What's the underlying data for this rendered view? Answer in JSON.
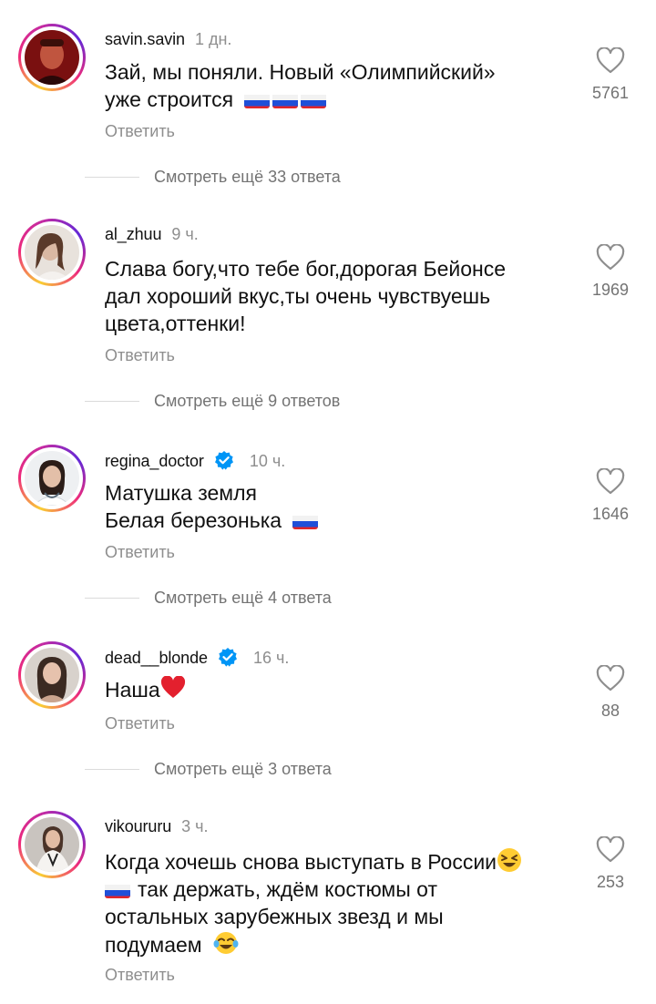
{
  "comments": [
    {
      "username": "savin.savin",
      "time": "1 дн.",
      "verified": false,
      "lines": [
        "Зай, мы поняли. Новый «Олимпийский»",
        "уже строится"
      ],
      "likes": "5761",
      "reply_label": "Ответить",
      "more_replies": "Смотреть ещё 33 ответа"
    },
    {
      "username": "al_zhuu",
      "time": "9 ч.",
      "verified": false,
      "lines": [
        "Слава богу,что тебе бог,дорогая Бейонсе",
        "дал хороший вкус,ты очень чувствуешь",
        "цвета,оттенки!"
      ],
      "likes": "1969",
      "reply_label": "Ответить",
      "more_replies": "Смотреть ещё 9 ответов"
    },
    {
      "username": "regina_doctor",
      "time": "10 ч.",
      "verified": true,
      "lines": [
        "Матушка земля",
        "Белая березонька"
      ],
      "likes": "1646",
      "reply_label": "Ответить",
      "more_replies": "Смотреть ещё 4 ответа"
    },
    {
      "username": "dead__blonde",
      "time": "16 ч.",
      "verified": true,
      "lines": [
        "Наша"
      ],
      "likes": "88",
      "reply_label": "Ответить",
      "more_replies": "Смотреть ещё 3 ответа"
    },
    {
      "username": "vikoururu",
      "time": "3 ч.",
      "verified": false,
      "lines": [
        "Когда хочешь снова выступать в России",
        "так держать, ждём костюмы от",
        "остальных зарубежных звезд и мы",
        "подумаем"
      ],
      "likes": "253",
      "reply_label": "Ответить"
    }
  ],
  "icons": {
    "like": "heart-outline-icon",
    "verified": "verified-badge-icon",
    "flag": "russia-flag-emoji",
    "heart_emoji": "red-heart-emoji",
    "laugh_emoji": "squinting-laughing-face-emoji",
    "tears_emoji": "face-with-tears-of-joy-emoji"
  },
  "colors": {
    "username": "#111111",
    "secondary": "#8e8e8e",
    "verified": "#0095f6",
    "story_ring_start": "#f9ce34",
    "story_ring_mid": "#ee2a7b",
    "story_ring_end": "#6228d7"
  }
}
